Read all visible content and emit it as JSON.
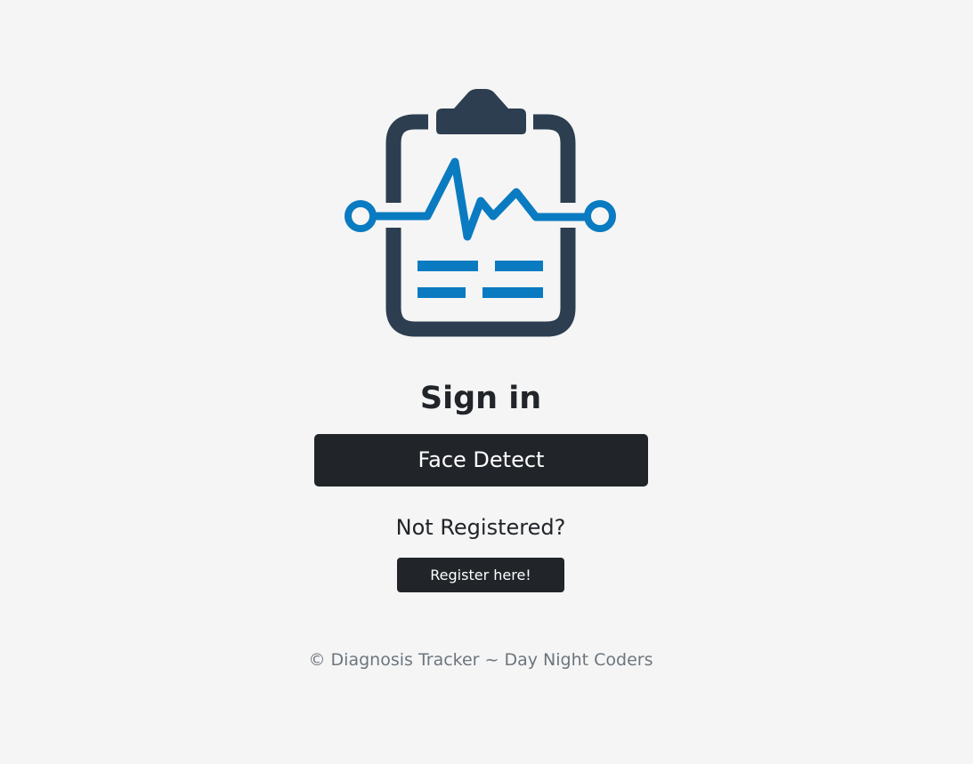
{
  "logo": {
    "icon": "clipboard-heartbeat-icon",
    "colors": {
      "clipboard": "#2c3e50",
      "accent": "#0a7bc1"
    }
  },
  "signin": {
    "title": "Sign in",
    "face_detect_label": "Face Detect"
  },
  "register": {
    "prompt": "Not Registered?",
    "button_label": "Register here!"
  },
  "footer": {
    "text": "© Diagnosis Tracker ~ Day Night Coders"
  },
  "colors": {
    "background": "#f5f5f5",
    "button": "#212529",
    "button_text": "#ffffff",
    "footer_text": "#6c757d"
  }
}
